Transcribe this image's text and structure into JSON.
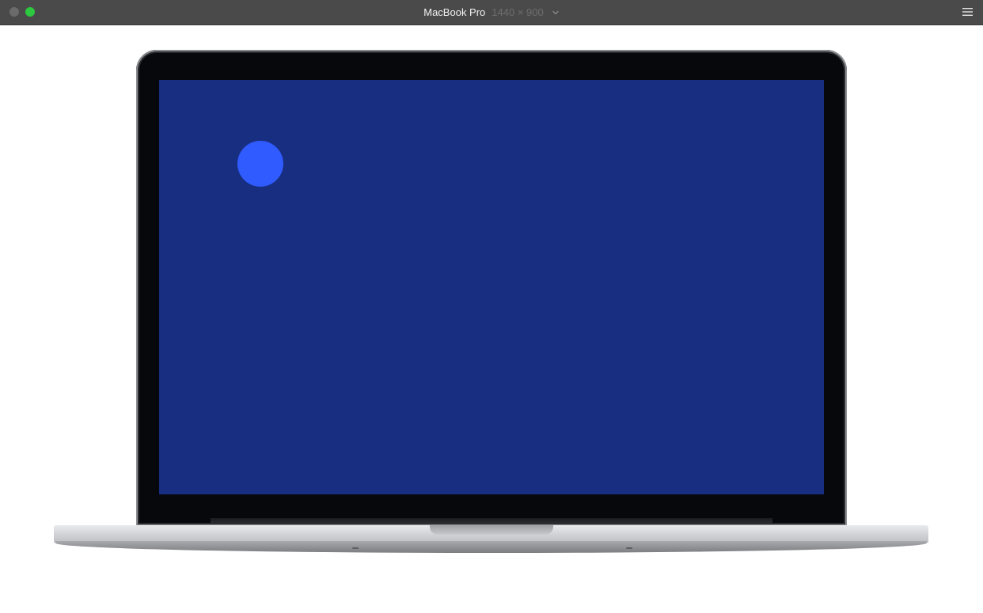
{
  "titlebar": {
    "device_name": "MacBook Pro",
    "resolution": "1440 × 900",
    "chevron_icon": "chevron-down-icon",
    "menu_icon": "hamburger-menu-icon"
  },
  "window_controls": {
    "close_color": "#6b6b6b",
    "zoom_color": "#2cc840"
  },
  "device_screen": {
    "background_color": "#182e80",
    "dot_color": "#2f5bff"
  }
}
